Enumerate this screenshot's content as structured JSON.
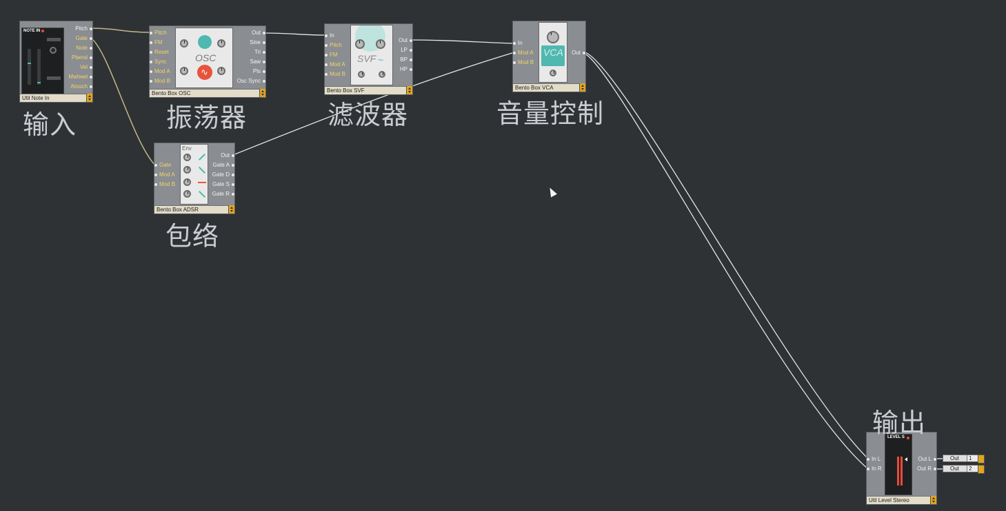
{
  "modules": {
    "note_in": {
      "panel_title": "NOTE IN",
      "footer": "Util Note In",
      "outputs": [
        "Pitch",
        "Gate",
        "Note",
        "Pbend",
        "Vel",
        "Mwheel",
        "Atouch"
      ]
    },
    "osc": {
      "panel_title": "OSC",
      "footer": "Bento Box OSC",
      "inputs": [
        "Pitch",
        "FM",
        "Reset",
        "Sync",
        "Mod A",
        "Mod B"
      ],
      "outputs": [
        "Out",
        "Sine",
        "Tri",
        "Saw",
        "Pls",
        "Osc Sync"
      ]
    },
    "svf": {
      "panel_title": "SVF",
      "footer": "Bento Box SVF",
      "inputs": [
        "In",
        "Pitch",
        "FM",
        "Mod A",
        "Mod B"
      ],
      "outputs": [
        "Out",
        "LP",
        "BP",
        "HP"
      ]
    },
    "vca": {
      "panel_title": "VCA",
      "footer": "Bento Box VCA",
      "inputs": [
        "In",
        "Mod A",
        "Mod B"
      ],
      "outputs": [
        "Out"
      ]
    },
    "adsr": {
      "panel_title": "Env",
      "footer": "Bento Box ADSR",
      "inputs": [
        "Gate",
        "Mod A",
        "Mod B"
      ],
      "outputs": [
        "Out",
        "Gate A",
        "Gate D",
        "Gate S",
        "Gate R"
      ]
    },
    "level": {
      "panel_title": "LEVEL S",
      "footer": "Util Level Stereo",
      "inputs": [
        "In L",
        "In R"
      ],
      "outputs": [
        "Out L",
        "Out R"
      ],
      "output_targets": [
        {
          "label": "Out",
          "channel": "1"
        },
        {
          "label": "Out",
          "channel": "2"
        }
      ]
    }
  },
  "annotations": {
    "input": "输入",
    "oscillator": "振荡器",
    "filter": "滤波器",
    "volume": "音量控制",
    "envelope": "包络",
    "output": "输出"
  },
  "colors": {
    "background": "#2f3235",
    "module_body": "#8a8d91",
    "footer": "#e2dcc8",
    "footer_button": "#e3a51d",
    "accent_teal": "#4fb8b0",
    "accent_red": "#e8533e",
    "wire_white": "#e6e6e6",
    "wire_tan": "#c4b88a"
  }
}
